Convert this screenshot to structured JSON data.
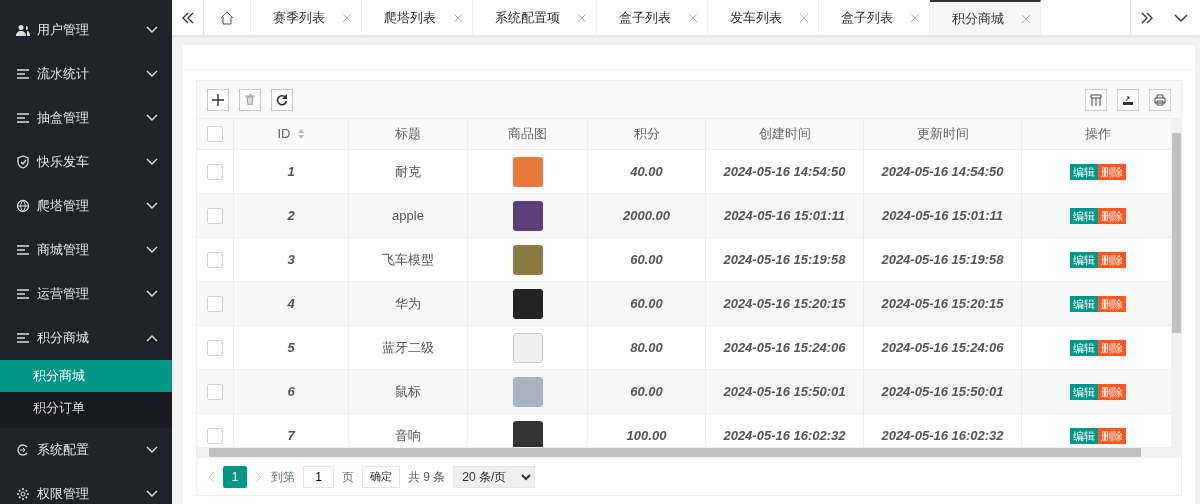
{
  "sidebar": {
    "items": [
      {
        "label": "用户管理",
        "expanded": false
      },
      {
        "label": "流水统计",
        "expanded": false
      },
      {
        "label": "抽盒管理",
        "expanded": false
      },
      {
        "label": "快乐发车",
        "expanded": false
      },
      {
        "label": "爬塔管理",
        "expanded": false
      },
      {
        "label": "商城管理",
        "expanded": false
      },
      {
        "label": "运营管理",
        "expanded": false
      },
      {
        "label": "积分商城",
        "expanded": true,
        "children": [
          {
            "label": "积分商城",
            "selected": true
          },
          {
            "label": "积分订单",
            "selected": false
          }
        ]
      },
      {
        "label": "系统配置",
        "expanded": false
      },
      {
        "label": "权限管理",
        "expanded": false
      }
    ]
  },
  "tabs": [
    {
      "label": "赛季列表",
      "selected": false
    },
    {
      "label": "爬塔列表",
      "selected": false
    },
    {
      "label": "系统配置项",
      "selected": false
    },
    {
      "label": "盒子列表",
      "selected": false
    },
    {
      "label": "发车列表",
      "selected": false
    },
    {
      "label": "盒子列表",
      "selected": false
    },
    {
      "label": "积分商城",
      "selected": true
    }
  ],
  "table": {
    "columns": [
      "ID",
      "标题",
      "商品图",
      "积分",
      "创建时间",
      "更新时间",
      "操作"
    ],
    "rows": [
      {
        "id": "1",
        "title": "耐克",
        "points": "40.00",
        "created": "2024-05-16 14:54:50",
        "updated": "2024-05-16 14:54:50",
        "checked": false,
        "actions": [
          "编辑",
          "删除"
        ]
      },
      {
        "id": "2",
        "title": "apple",
        "points": "2000.00",
        "created": "2024-05-16 15:01:11",
        "updated": "2024-05-16 15:01:11",
        "checked": false,
        "actions": [
          "编辑",
          "删除"
        ]
      },
      {
        "id": "3",
        "title": "飞车模型",
        "points": "60.00",
        "created": "2024-05-16 15:19:58",
        "updated": "2024-05-16 15:19:58",
        "checked": false,
        "actions": [
          "编辑",
          "删除"
        ]
      },
      {
        "id": "4",
        "title": "华为",
        "points": "60.00",
        "created": "2024-05-16 15:20:15",
        "updated": "2024-05-16 15:20:15",
        "checked": false,
        "actions": [
          "编辑",
          "删除"
        ]
      },
      {
        "id": "5",
        "title": "蓝牙二级",
        "points": "80.00",
        "created": "2024-05-16 15:24:06",
        "updated": "2024-05-16 15:24:06",
        "checked": false,
        "actions": [
          "编辑",
          "删除"
        ]
      },
      {
        "id": "6",
        "title": "鼠标",
        "points": "60.00",
        "created": "2024-05-16 15:50:01",
        "updated": "2024-05-16 15:50:01",
        "checked": false,
        "actions": [
          "编辑",
          "删除"
        ]
      },
      {
        "id": "7",
        "title": "音响",
        "points": "100.00",
        "created": "2024-05-16 16:02:32",
        "updated": "2024-05-16 16:02:32",
        "checked": false,
        "actions": [
          "编辑",
          "删除"
        ]
      }
    ],
    "select_all_checked": false
  },
  "pagination": {
    "current": "1",
    "goto_label": "到第",
    "goto_value": "1",
    "page_label": "页",
    "confirm": "确定",
    "total": "共 9 条",
    "page_size": "20 条/页"
  }
}
